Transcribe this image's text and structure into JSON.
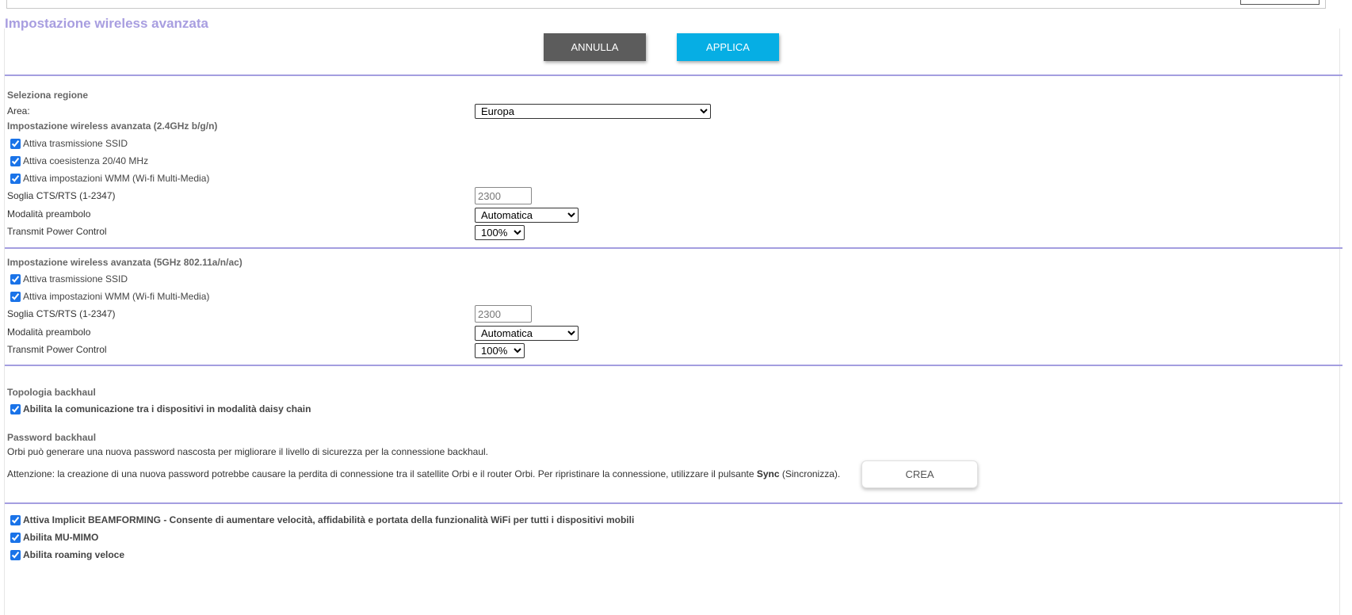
{
  "page": {
    "title": "Impostazione wireless avanzata"
  },
  "buttons": {
    "cancel": "ANNULLA",
    "apply": "APPLICA",
    "create": "CREA"
  },
  "region": {
    "heading": "Seleziona regione",
    "area_label": "Area:",
    "area_value": "Europa"
  },
  "band24": {
    "heading": "Impostazione wireless avanzata (2.4GHz b/g/n)",
    "ssid_broadcast": "Attiva trasmissione SSID",
    "coexistence": "Attiva coesistenza 20/40 MHz",
    "wmm": "Attiva impostazioni WMM (Wi-fi Multi-Media)",
    "cts_label": "Soglia CTS/RTS (1-2347)",
    "cts_value": "2300",
    "preamble_label": "Modalità preambolo",
    "preamble_value": "Automatica",
    "power_label": "Transmit Power Control",
    "power_value": "100%"
  },
  "band5": {
    "heading": "Impostazione wireless avanzata (5GHz 802.11a/n/ac)",
    "ssid_broadcast": "Attiva trasmissione SSID",
    "wmm": "Attiva impostazioni WMM (Wi-fi Multi-Media)",
    "cts_label": "Soglia CTS/RTS (1-2347)",
    "cts_value": "2300",
    "preamble_label": "Modalità preambolo",
    "preamble_value": "Automatica",
    "power_label": "Transmit Power Control",
    "power_value": "100%"
  },
  "backhaul": {
    "topology_heading": "Topologia backhaul",
    "daisy_chain": "Abilita la comunicazione tra i dispositivi in modalità daisy chain",
    "password_heading": "Password backhaul",
    "password_info": "Orbi può generare una nuova password nascosta per migliorare il livello di sicurezza per la connessione backhaul.",
    "warning_before": "Attenzione: la creazione di una nuova password potrebbe causare la perdita di connessione tra il satellite Orbi e il router Orbi. Per ripristinare la connessione, utilizzare il pulsante ",
    "warning_bold": "Sync",
    "warning_after": " (Sincronizza)."
  },
  "extras": {
    "beamforming": "Attiva Implicit BEAMFORMING - Consente di aumentare velocità, affidabilità e portata della funzionalità WiFi per tutti i dispositivi mobili",
    "mumimo": "Abilita MU-MIMO",
    "fast_roaming": "Abilita roaming veloce"
  },
  "colors": {
    "title": "#a89ee0",
    "separator": "#a49ee0",
    "cancel_bg": "#5c5c5c",
    "apply_bg": "#06aee4"
  }
}
